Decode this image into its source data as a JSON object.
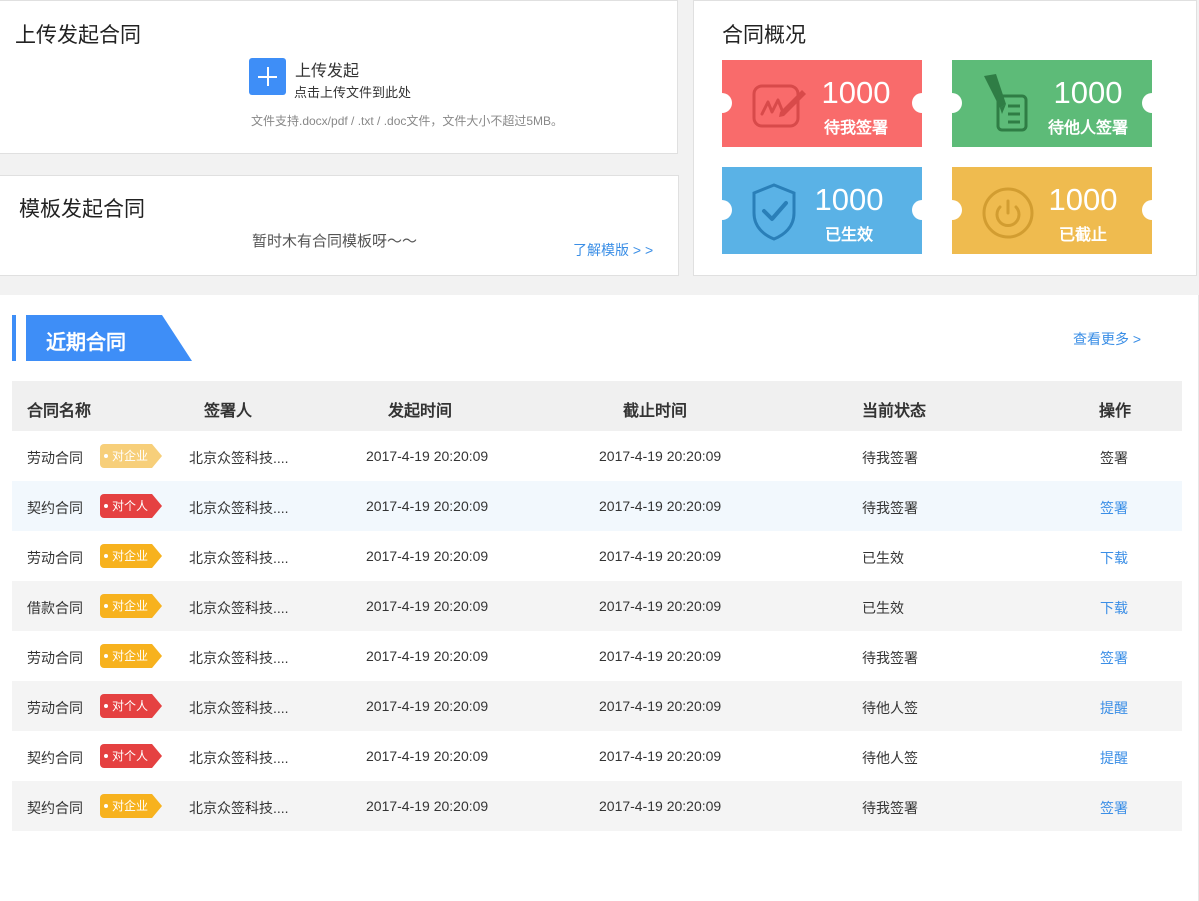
{
  "upload": {
    "title": "上传发起合同",
    "button_label": "上传发起",
    "hint": "点击上传文件到此处",
    "note": "文件支持.docx/pdf / .txt / .doc文件，文件大小不超过5MB。"
  },
  "template": {
    "title": "模板发起合同",
    "empty_text": "暂时木有合同模板呀～～",
    "learn_link": "了解模版 > >"
  },
  "overview": {
    "title": "合同概况",
    "cards": [
      {
        "count": "1000",
        "label": "待我签署",
        "color": "#f96b6b",
        "icon": "signature-icon"
      },
      {
        "count": "1000",
        "label": "待他人签署",
        "color": "#5dbb78",
        "icon": "pen-document-icon"
      },
      {
        "count": "1000",
        "label": "已生效",
        "color": "#5ab2e6",
        "icon": "shield-check-icon"
      },
      {
        "count": "1000",
        "label": "已截止",
        "color": "#efbb4f",
        "icon": "power-icon"
      }
    ]
  },
  "recent": {
    "title": "近期合同",
    "more_link": "查看更多 >",
    "columns": [
      "合同名称",
      "签署人",
      "发起时间",
      "截止时间",
      "当前状态",
      "操作"
    ],
    "rows": [
      {
        "name": "劳动合同",
        "tag": "对企业",
        "signer": "北京众签科技....",
        "start": "2017-4-19 20:20:09",
        "end": "2017-4-19 20:20:09",
        "status": "待我签署",
        "op": "签署"
      },
      {
        "name": "契约合同",
        "tag": "对个人",
        "signer": "北京众签科技....",
        "start": "2017-4-19 20:20:09",
        "end": "2017-4-19 20:20:09",
        "status": "待我签署",
        "op": "签署"
      },
      {
        "name": "劳动合同",
        "tag": "对企业",
        "signer": "北京众签科技....",
        "start": "2017-4-19 20:20:09",
        "end": "2017-4-19 20:20:09",
        "status": "已生效",
        "op": "下载"
      },
      {
        "name": "借款合同",
        "tag": "对企业",
        "signer": "北京众签科技....",
        "start": "2017-4-19 20:20:09",
        "end": "2017-4-19 20:20:09",
        "status": "已生效",
        "op": "下载"
      },
      {
        "name": "劳动合同",
        "tag": "对企业",
        "signer": "北京众签科技....",
        "start": "2017-4-19 20:20:09",
        "end": "2017-4-19 20:20:09",
        "status": "待我签署",
        "op": "签署"
      },
      {
        "name": "劳动合同",
        "tag": "对个人",
        "signer": "北京众签科技....",
        "start": "2017-4-19 20:20:09",
        "end": "2017-4-19 20:20:09",
        "status": "待他人签",
        "op": "提醒"
      },
      {
        "name": "契约合同",
        "tag": "对个人",
        "signer": "北京众签科技....",
        "start": "2017-4-19 20:20:09",
        "end": "2017-4-19 20:20:09",
        "status": "待他人签",
        "op": "提醒"
      },
      {
        "name": "契约合同",
        "tag": "对企业",
        "signer": "北京众签科技....",
        "start": "2017-4-19 20:20:09",
        "end": "2017-4-19 20:20:09",
        "status": "待我签署",
        "op": "签署"
      }
    ]
  },
  "colors": {
    "accent": "#3e8ef7",
    "link": "#3a8ee6",
    "tag_enterprise": "#f7b21e",
    "tag_personal": "#e54141"
  }
}
